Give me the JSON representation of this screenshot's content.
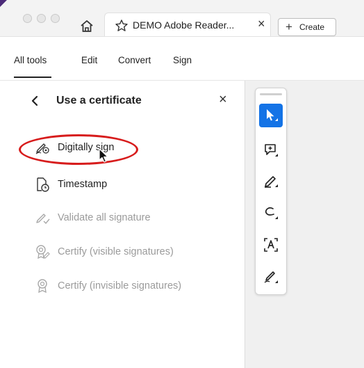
{
  "browser": {
    "tab_title": "DEMO Adobe Reader...",
    "tab_close": "×",
    "create_button": "Create",
    "create_plus": "+"
  },
  "menu": {
    "items": [
      "All tools",
      "Edit",
      "Convert",
      "Sign"
    ],
    "active": "All tools"
  },
  "panel": {
    "title": "Use a certificate",
    "close": "×",
    "items": [
      {
        "label": "Digitally sign",
        "enabled": true,
        "icon": "digital-sign-icon"
      },
      {
        "label": "Timestamp",
        "enabled": true,
        "icon": "timestamp-icon"
      },
      {
        "label": "Validate all signature",
        "enabled": false,
        "icon": "validate-signature-icon"
      },
      {
        "label": "Certify (visible signatures)",
        "enabled": false,
        "icon": "certify-visible-icon"
      },
      {
        "label": "Certify (invisible signatures)",
        "enabled": false,
        "icon": "certify-invisible-icon"
      }
    ]
  },
  "toolbar": {
    "tools": [
      "select-tool-icon",
      "add-comment-icon",
      "highlight-pen-icon",
      "draw-freeform-icon",
      "text-recognition-icon",
      "fill-sign-icon"
    ],
    "active_tool": "select-tool-icon"
  },
  "colors": {
    "accent": "#1473e6",
    "annotation_red": "#d71c1c"
  }
}
